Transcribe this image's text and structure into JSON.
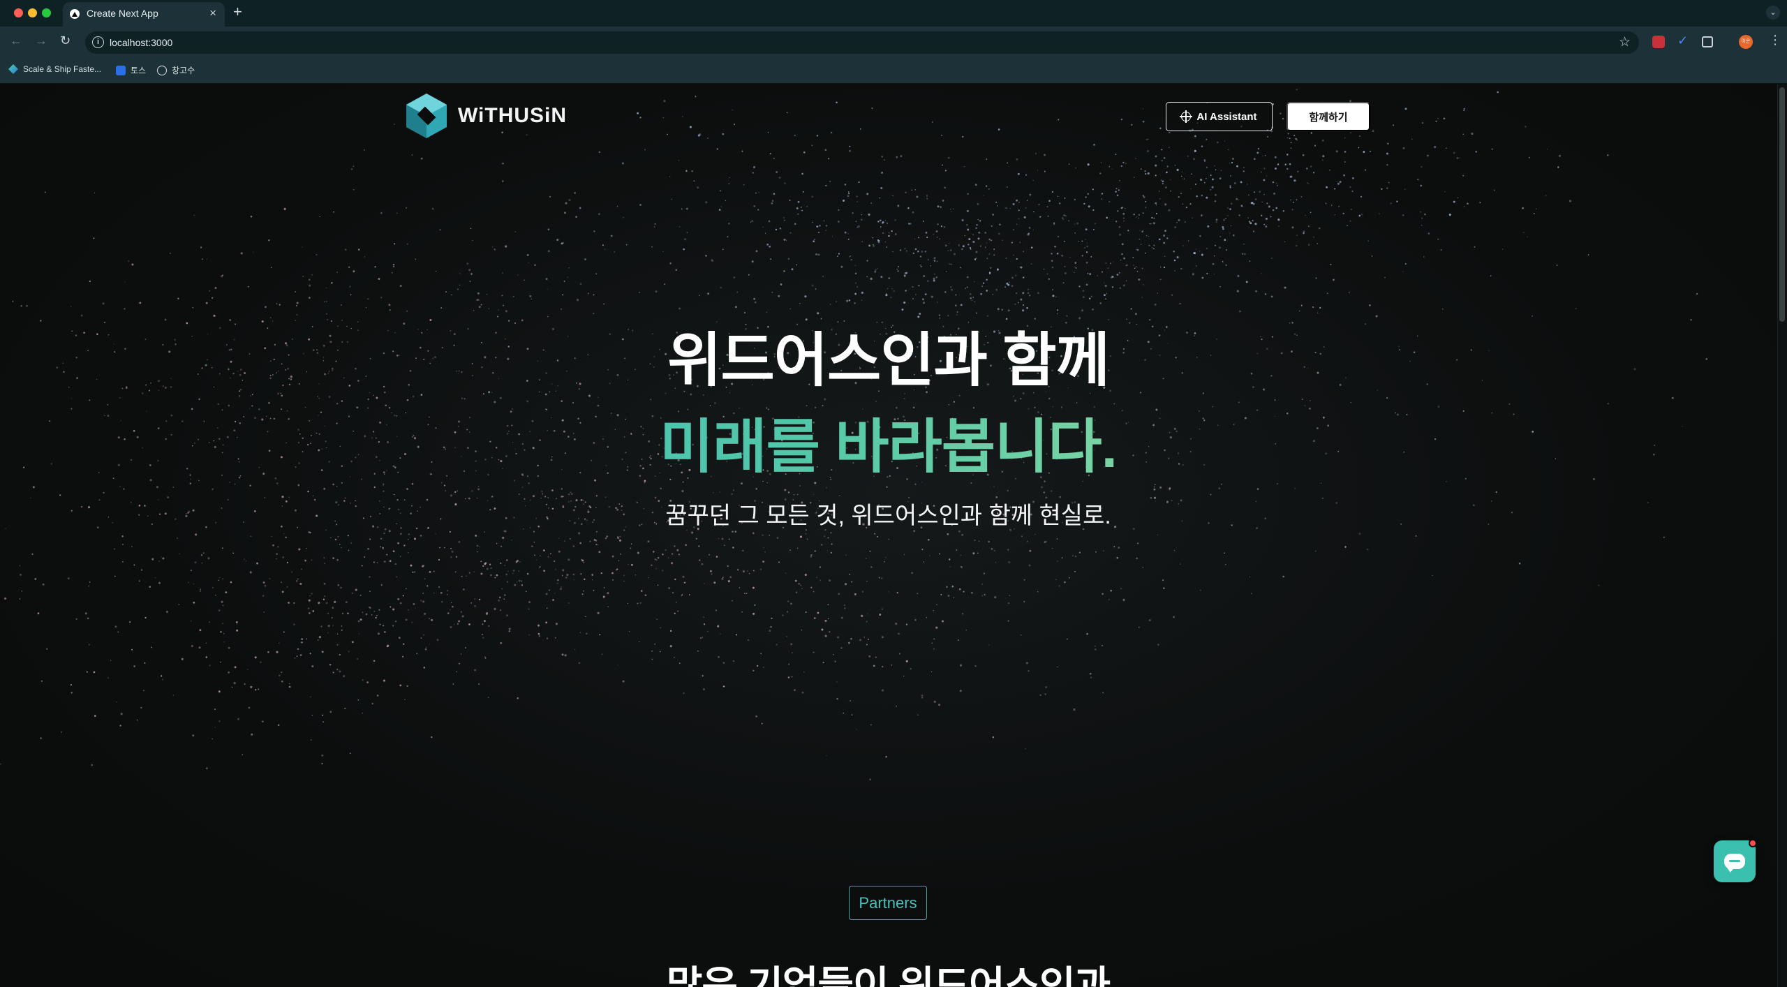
{
  "browser": {
    "tab_title": "Create Next App",
    "new_tab_symbol": "+",
    "close_symbol": "×",
    "url": "localhost:3000",
    "profile_initials": "이은",
    "bookmarks": [
      {
        "label": "Scale & Ship Faste..."
      },
      {
        "label": "토스"
      },
      {
        "label": "창고수"
      }
    ]
  },
  "header": {
    "logo_text": "WiTHUSiN",
    "ai_button_label": "AI Assistant",
    "join_button_label": "함께하기"
  },
  "hero": {
    "title_line1": "위드어스인과 함께",
    "title_line2": "미래를 바라봅니다.",
    "subtitle": "꿈꾸던 그 모든 것, 위드어스인과 함께 현실로."
  },
  "partners": {
    "badge": "Partners",
    "title": "많은 기업들이 위드어스인과"
  },
  "colors": {
    "accent_teal": "#3bbfae",
    "gradient_start": "#37b9c9",
    "gradient_end": "#c8f0a6",
    "background": "#0b0d0d"
  },
  "icons": {
    "chat": "chat-bubble-icon",
    "ai": "crosshair-icon"
  }
}
